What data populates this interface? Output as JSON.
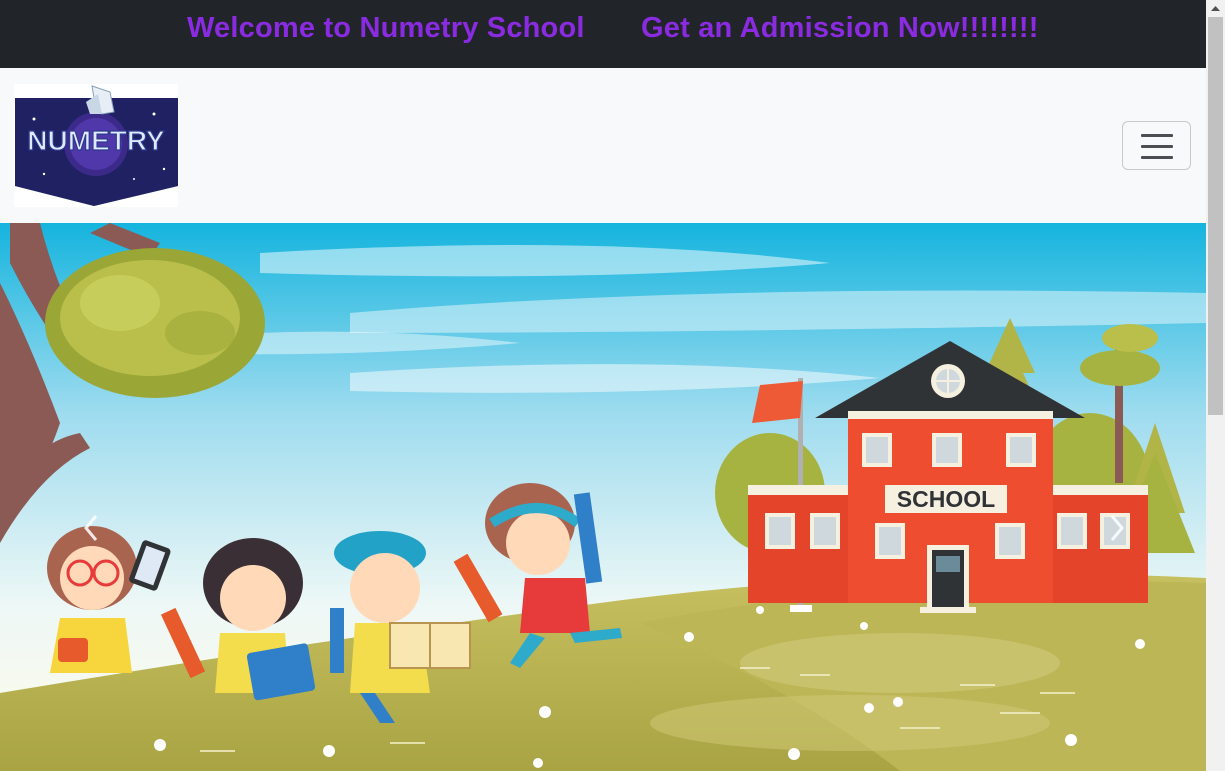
{
  "topbar": {
    "welcome_text": "Welcome to Numetry School",
    "admission_text": "Get an Admission Now!!!!!!!!",
    "text_color": "#8a2be2",
    "background": "#212529"
  },
  "navbar": {
    "logo_text": "NUMETRY",
    "toggler_icon": "hamburger-menu-icon"
  },
  "hero": {
    "school_sign": "SCHOOL",
    "prev_icon": "chevron-left-icon",
    "next_icon": "chevron-right-icon"
  }
}
